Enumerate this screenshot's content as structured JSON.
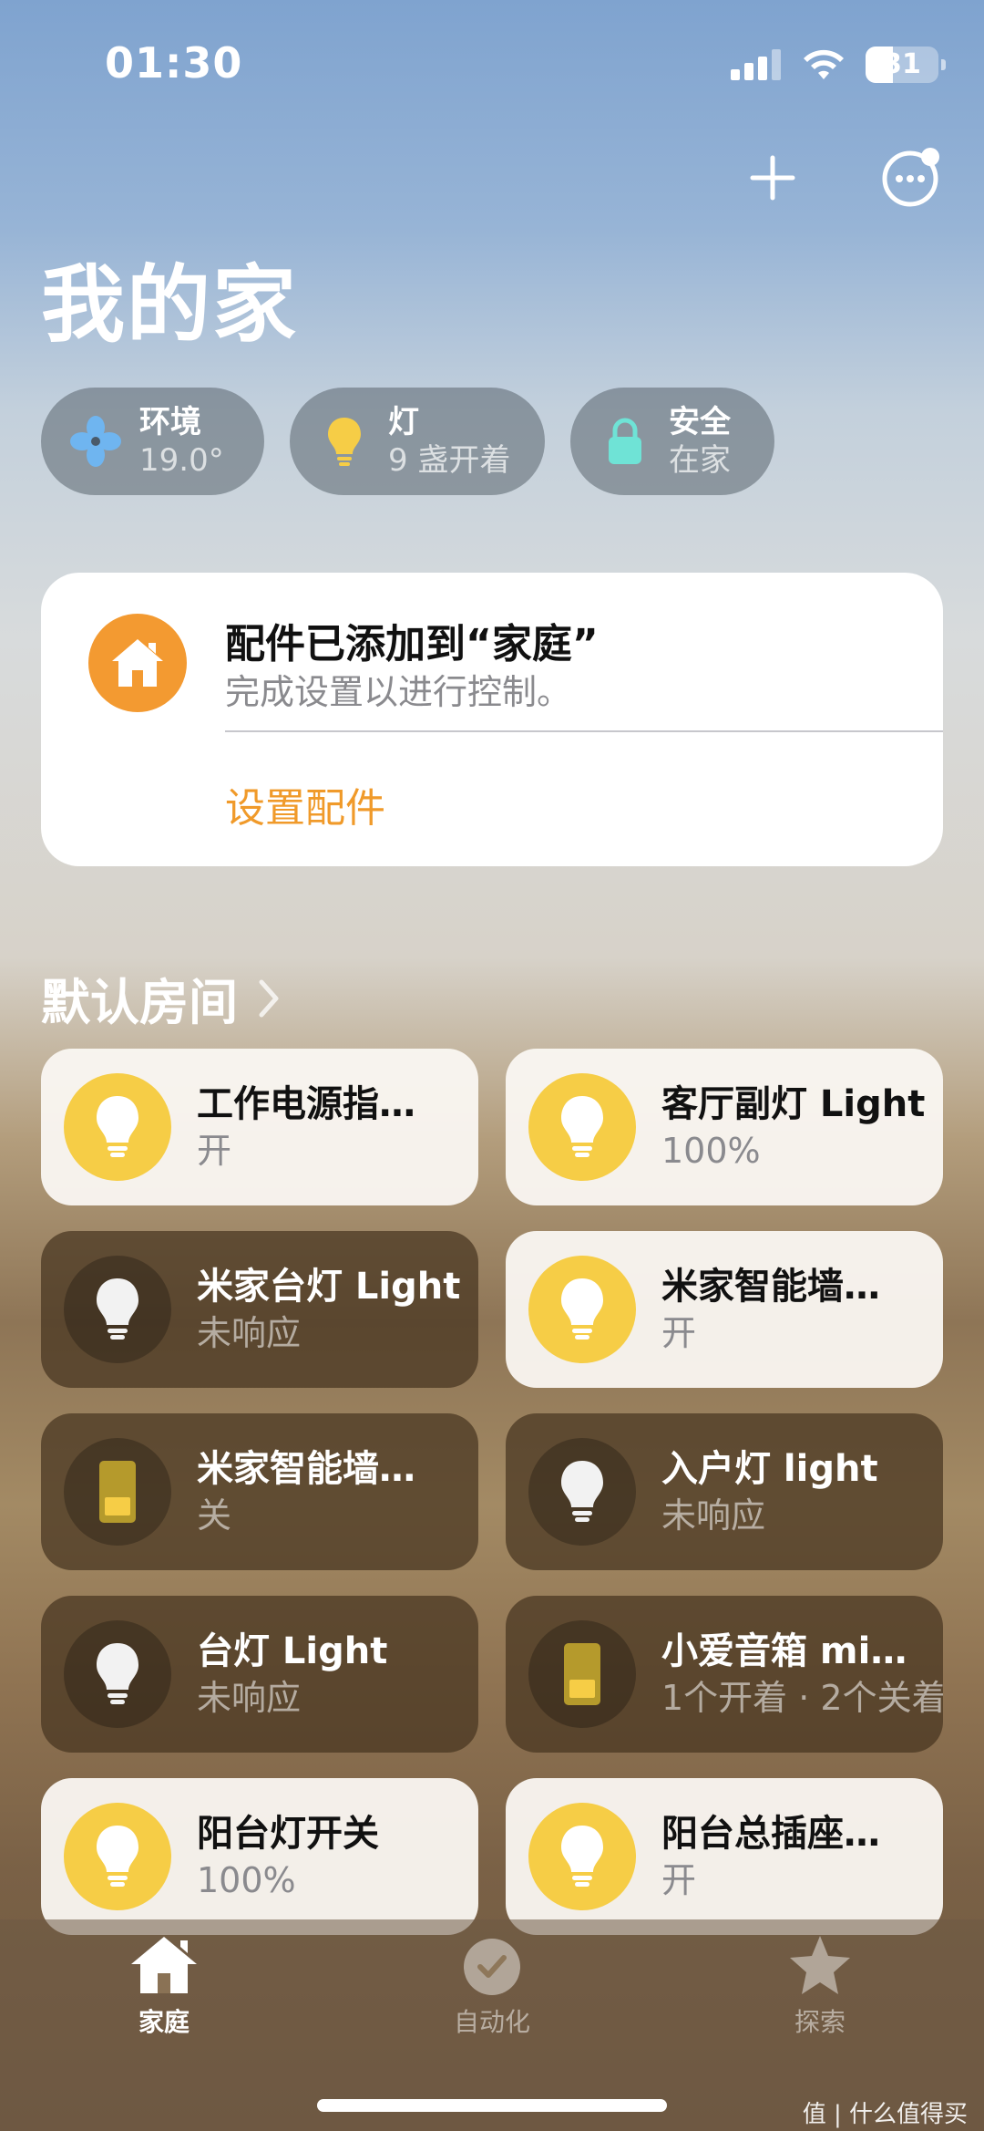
{
  "status_bar": {
    "time": "01:30",
    "battery": "31"
  },
  "header": {
    "title": "我的家",
    "add_icon": "plus-icon",
    "more_icon": "ellipsis-circle-icon"
  },
  "categories": [
    {
      "title": "环境",
      "value": "19.0°",
      "icon": "fan-icon"
    },
    {
      "title": "灯",
      "value": "9 盏开着",
      "icon": "lightbulb-icon"
    },
    {
      "title": "安全",
      "value": "在家",
      "icon": "lock-icon"
    }
  ],
  "banner": {
    "title": "配件已添加到“家庭”",
    "subtitle": "完成设置以进行控制。",
    "action": "设置配件",
    "accent": "#f39a31"
  },
  "section": {
    "title": "默认房间"
  },
  "accessories": [
    {
      "name": "工作电源指…",
      "status": "开",
      "state": "on",
      "icon": "lightbulb-icon"
    },
    {
      "name": "客厅副灯 Light",
      "status": "100%",
      "state": "on",
      "icon": "lightbulb-icon"
    },
    {
      "name": "米家台灯 Light",
      "status": "未响应",
      "state": "off",
      "icon": "lightbulb-icon"
    },
    {
      "name": "米家智能墙…",
      "status": "开",
      "state": "on",
      "icon": "lightbulb-icon"
    },
    {
      "name": "米家智能墙…",
      "status": "关",
      "state": "off",
      "icon": "switch-icon"
    },
    {
      "name": "入户灯 light",
      "status": "未响应",
      "state": "off",
      "icon": "lightbulb-icon"
    },
    {
      "name": "台灯 Light",
      "status": "未响应",
      "state": "off",
      "icon": "lightbulb-icon"
    },
    {
      "name": "小爱音箱 mi…",
      "status": "1个开着 · 2个关着",
      "state": "off",
      "icon": "switch-icon"
    },
    {
      "name": "阳台灯开关",
      "status": "100%",
      "state": "on",
      "icon": "lightbulb-icon"
    },
    {
      "name": "阳台总插座…",
      "status": "开",
      "state": "on",
      "icon": "lightbulb-icon"
    }
  ],
  "tabs": [
    {
      "label": "家庭",
      "icon": "house-icon",
      "active": true
    },
    {
      "label": "自动化",
      "icon": "clock-check-icon",
      "active": false
    },
    {
      "label": "探索",
      "icon": "star-icon",
      "active": false
    }
  ],
  "watermark": "值 | 什么值得买",
  "colors": {
    "accent": "#f09a2a",
    "bulb_on": "#f6cd46",
    "lock": "#6fe3d6",
    "fan": "#6fb5f0"
  }
}
